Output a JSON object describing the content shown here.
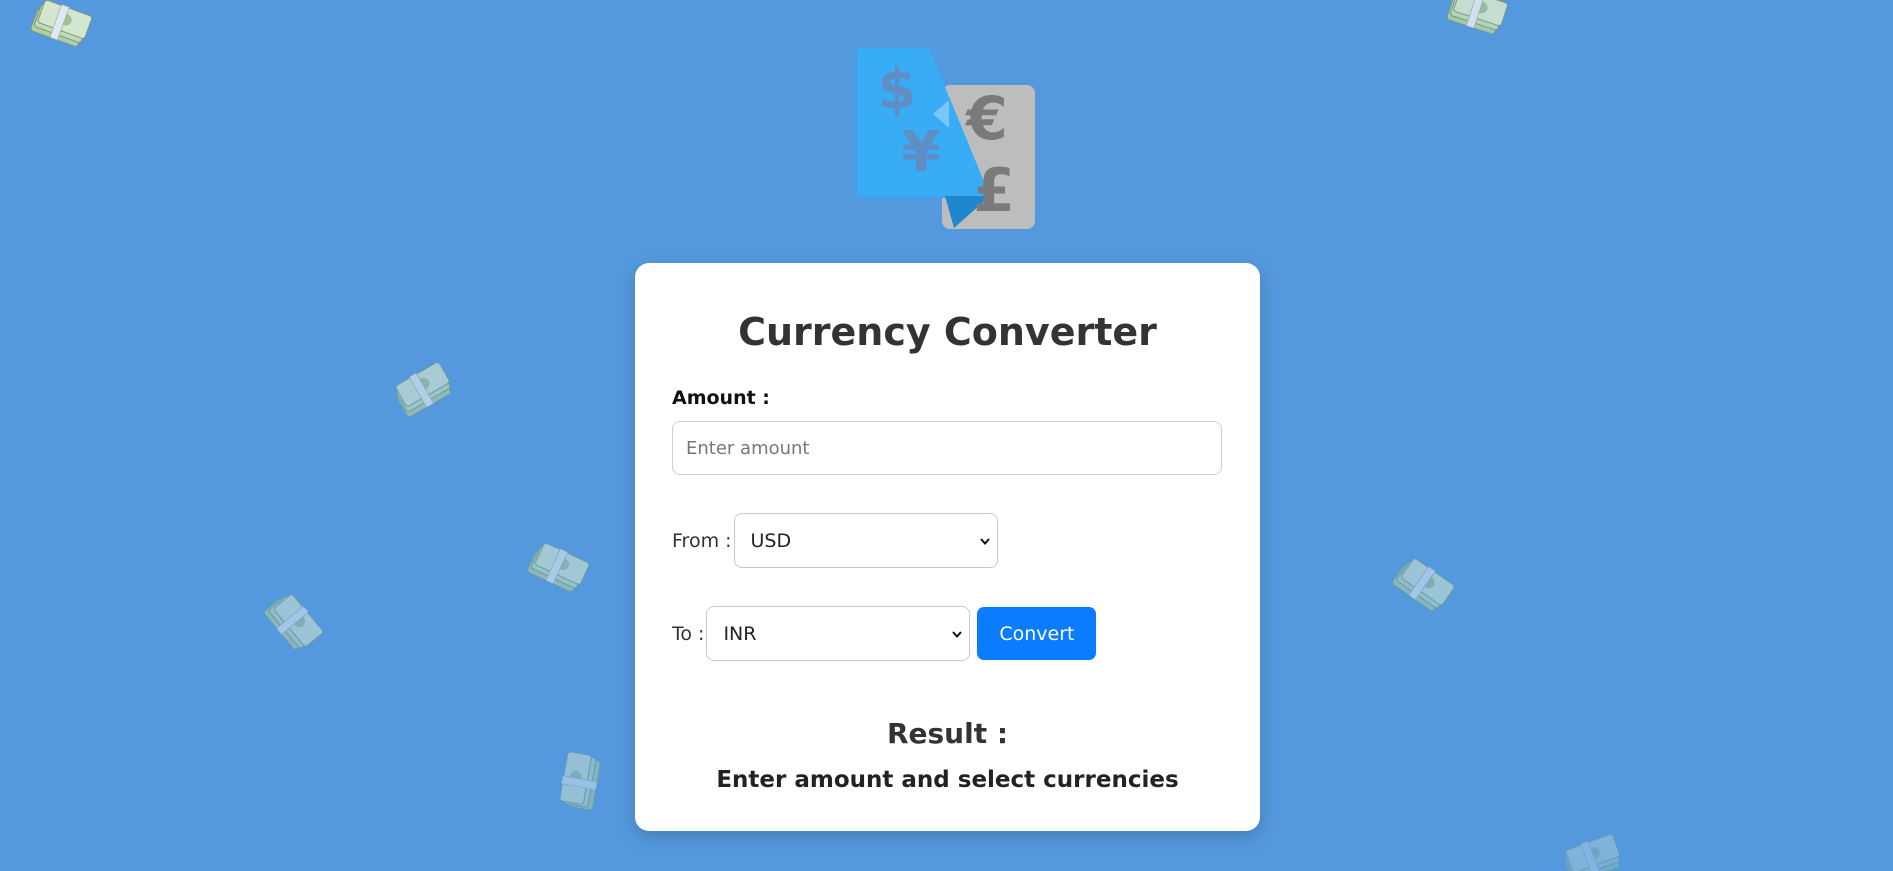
{
  "colors": {
    "background": "#5499de",
    "card": "#ffffff",
    "accent": "#0a7cff"
  },
  "logo": {
    "icon": "currency-exchange-icon",
    "symbols": [
      "$",
      "¥",
      "€",
      "£"
    ]
  },
  "background_decor": {
    "icon": "money-stack-icon"
  },
  "converter": {
    "title": "Currency Converter",
    "amount_label": "Amount :",
    "amount_value": "",
    "amount_placeholder": "Enter amount",
    "from_label": "From :",
    "from_value": "USD",
    "to_label": "To :",
    "to_value": "INR",
    "convert_label": "Convert",
    "result_title": "Result :",
    "result_text": "Enter amount and select currencies"
  }
}
